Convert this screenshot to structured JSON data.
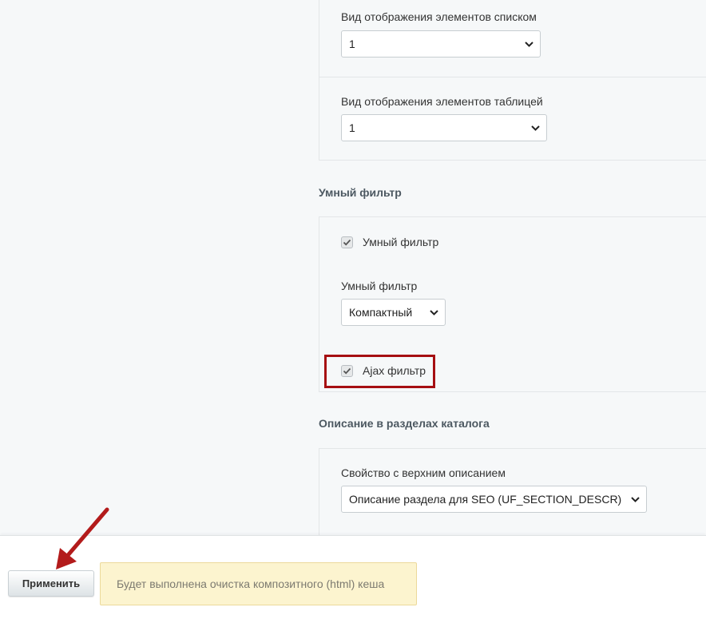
{
  "list_view": {
    "label": "Вид отображения элементов списком",
    "value": "1"
  },
  "table_view": {
    "label": "Вид отображения элементов таблицей",
    "value": "1"
  },
  "smart_filter_section": {
    "title": "Умный фильтр",
    "checkbox_label": "Умный фильтр",
    "checkbox_checked": true,
    "select_label": "Умный фильтр",
    "select_value": "Компактный",
    "ajax_checkbox_label": "Ajax фильтр",
    "ajax_checkbox_checked": true
  },
  "description_section": {
    "title": "Описание в разделах каталога",
    "select_label": "Свойство с верхним описанием",
    "select_value": "Описание раздела для SEO (UF_SECTION_DESCR)"
  },
  "footer": {
    "apply_label": "Применить",
    "notice_text": "Будет выполнена очистка композитного (html) кеша"
  },
  "colors": {
    "highlight": "#a60f12",
    "arrow": "#b31b1b",
    "notice_bg": "#fcf4cf"
  }
}
